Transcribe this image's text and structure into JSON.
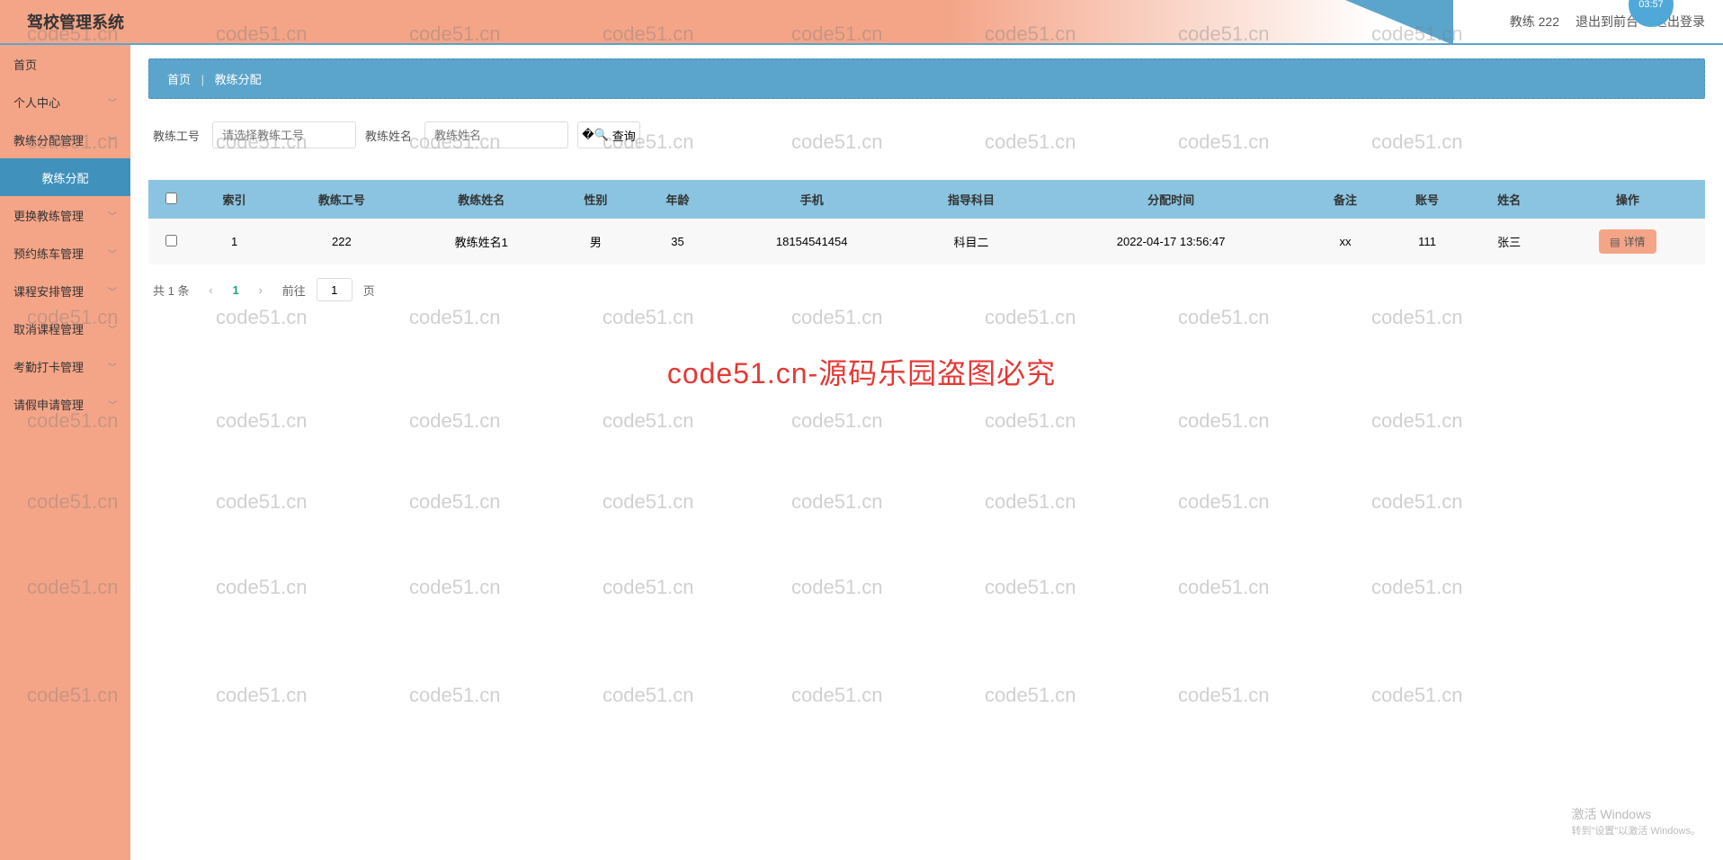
{
  "header": {
    "title": "驾校管理系统",
    "user_label": "教练 222",
    "exit_front": "退出到前台",
    "logout": "退出登录",
    "clock": "03:57"
  },
  "sidebar": {
    "items": [
      {
        "label": "首页",
        "expandable": false
      },
      {
        "label": "个人中心",
        "expandable": true
      },
      {
        "label": "教练分配管理",
        "expandable": true
      },
      {
        "label": "教练分配",
        "expandable": false,
        "active": true
      },
      {
        "label": "更换教练管理",
        "expandable": true
      },
      {
        "label": "预约练车管理",
        "expandable": true
      },
      {
        "label": "课程安排管理",
        "expandable": true
      },
      {
        "label": "取消课程管理",
        "expandable": true
      },
      {
        "label": "考勤打卡管理",
        "expandable": true
      },
      {
        "label": "请假申请管理",
        "expandable": true
      }
    ]
  },
  "breadcrumb": {
    "home": "首页",
    "current": "教练分配"
  },
  "search": {
    "coach_id_label": "教练工号",
    "coach_id_placeholder": "请选择教练工号",
    "coach_name_label": "教练姓名",
    "coach_name_placeholder": "教练姓名",
    "query_btn": "查询"
  },
  "table": {
    "headers": [
      "索引",
      "教练工号",
      "教练姓名",
      "性别",
      "年龄",
      "手机",
      "指导科目",
      "分配时间",
      "备注",
      "账号",
      "姓名",
      "操作"
    ],
    "rows": [
      {
        "cells": [
          "1",
          "222",
          "教练姓名1",
          "男",
          "35",
          "18154541454",
          "科目二",
          "2022-04-17 13:56:47",
          "xx",
          "111",
          "张三"
        ],
        "action": "详情"
      }
    ]
  },
  "pagination": {
    "total_text": "共 1 条",
    "current": "1",
    "goto_label": "前往",
    "goto_value": "1",
    "page_unit": "页"
  },
  "watermark": {
    "repeat": "code51.cn",
    "center": "code51.cn-源码乐园盗图必究"
  },
  "activate": {
    "title": "激活 Windows",
    "sub": "转到\"设置\"以激活 Windows。"
  }
}
